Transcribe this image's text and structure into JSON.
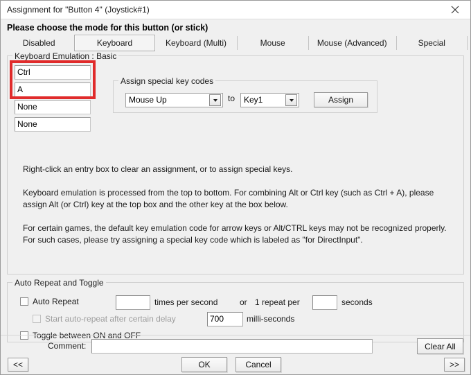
{
  "titlebar": {
    "title": "Assignment for \"Button 4\" (Joystick#1)",
    "close_icon": "close-icon"
  },
  "prompt": "Please choose the mode for this button (or stick)",
  "tabs": [
    {
      "label": "Disabled",
      "selected": false
    },
    {
      "label": "Keyboard",
      "selected": true
    },
    {
      "label": "Keyboard (Multi)",
      "selected": false
    },
    {
      "label": "Mouse",
      "selected": false
    },
    {
      "label": "Mouse (Advanced)",
      "selected": false
    },
    {
      "label": "Special",
      "selected": false
    }
  ],
  "keyboard_group": {
    "title": "Keyboard Emulation : Basic",
    "entries": [
      {
        "value": "Ctrl",
        "highlighted": true
      },
      {
        "value": "A",
        "highlighted": true
      },
      {
        "value": "None",
        "highlighted": false
      },
      {
        "value": "None",
        "highlighted": false
      }
    ],
    "highlight_color": "#e02b2b",
    "special_codes": {
      "title": "Assign special key codes",
      "source_value": "Mouse Up",
      "to_label": "to",
      "target_value": "Key1",
      "assign_label": "Assign"
    },
    "help": [
      "Right-click an entry box to clear an assignment, or to assign special keys.",
      "Keyboard emulation is processed from the top to bottom.  For combining Alt or Ctrl key (such as Ctrl + A), please assign Alt (or Ctrl) key at the top box and the other key at the box below.",
      "For certain games, the default key emulation code for arrow keys or Alt/CTRL keys may not be recognized properly. For such cases, please try assigning a special key code which is labeled as \"for DirectInput\"."
    ]
  },
  "auto_repeat_group": {
    "title": "Auto Repeat and Toggle",
    "auto_repeat_label": "Auto Repeat",
    "auto_repeat_checked": false,
    "times_value": "",
    "times_label": "times per second",
    "or_label": "or",
    "one_repeat_label": "1 repeat per",
    "seconds_value": "",
    "seconds_label": "seconds",
    "delay_label": "Start auto-repeat after certain delay",
    "delay_checked": false,
    "delay_enabled": false,
    "delay_value": "700",
    "milliseconds_label": "milli-seconds",
    "toggle_label": "Toggle between ON and OFF",
    "toggle_checked": false
  },
  "bottom": {
    "comment_label": "Comment:",
    "comment_value": "",
    "clear_all_label": "Clear All",
    "prev_label": "<<",
    "ok_label": "OK",
    "cancel_label": "Cancel",
    "next_label": ">>"
  }
}
